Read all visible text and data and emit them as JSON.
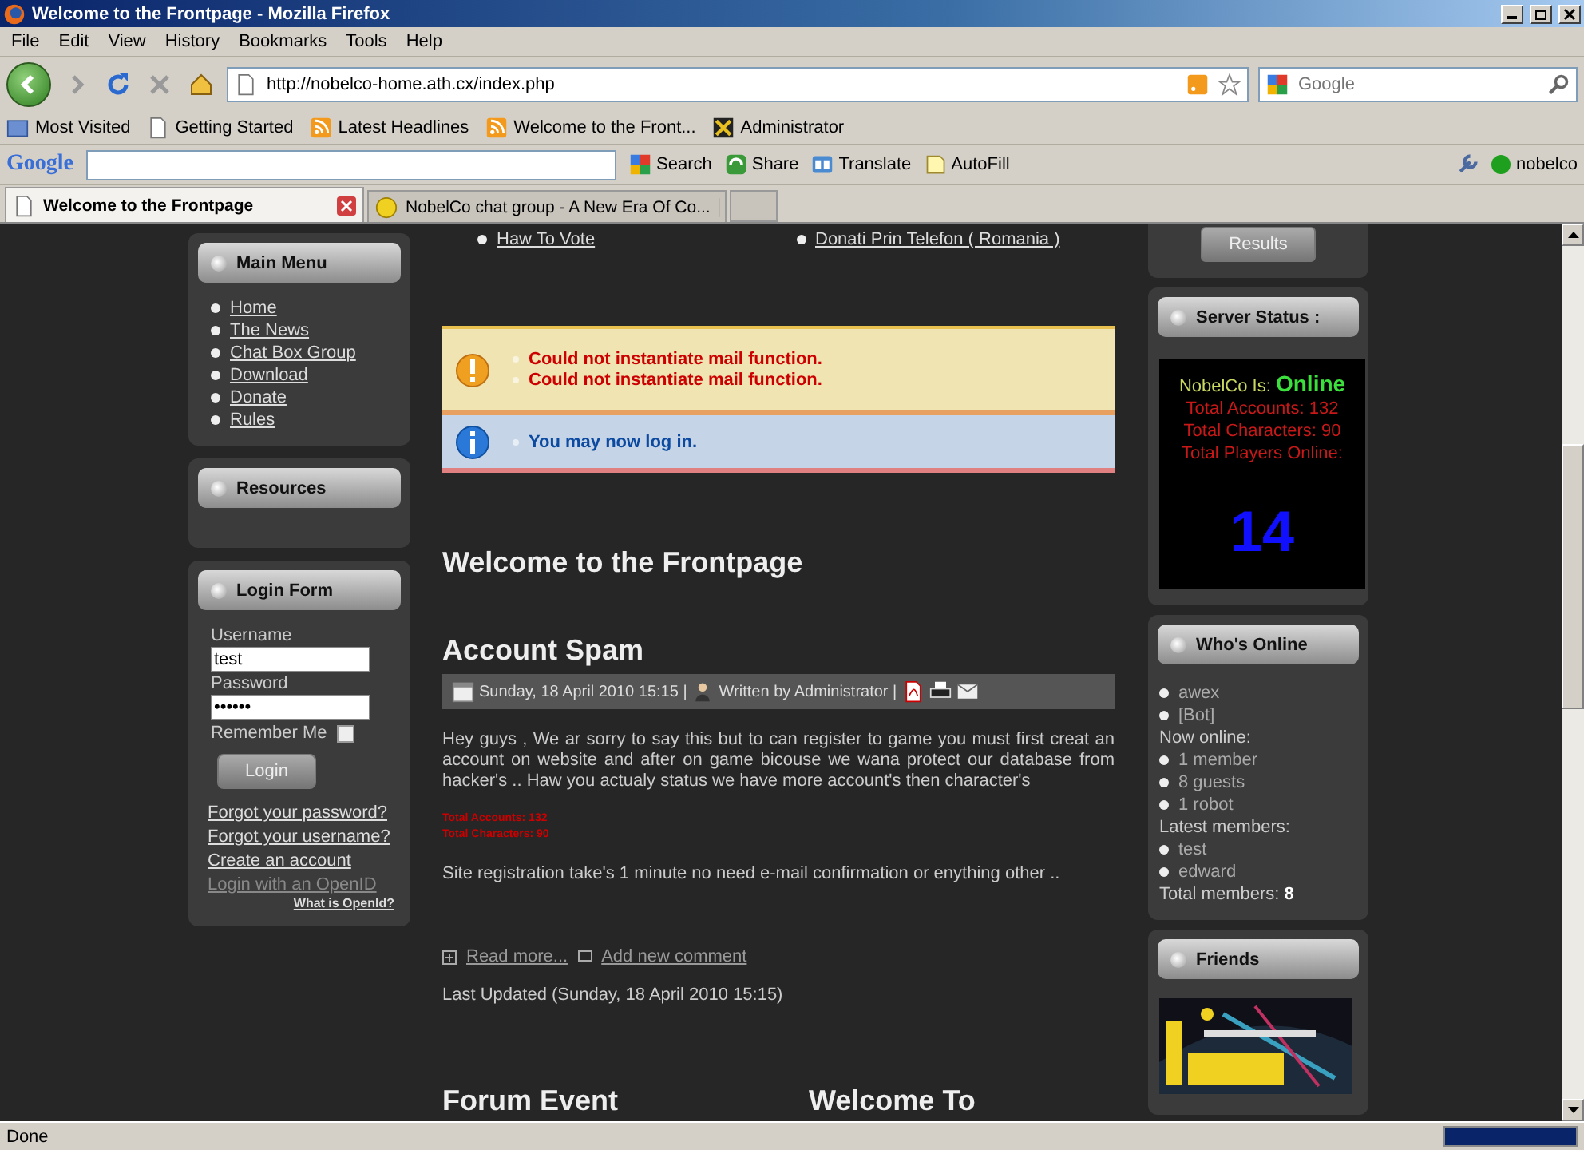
{
  "window": {
    "title": "Welcome to the Frontpage - Mozilla Firefox"
  },
  "menu_bar": [
    "File",
    "Edit",
    "View",
    "History",
    "Bookmarks",
    "Tools",
    "Help"
  ],
  "address_bar": {
    "url": "http://nobelco-home.ath.cx/index.php"
  },
  "search_box": {
    "placeholder": "Google"
  },
  "bookmarks": [
    {
      "label": "Most Visited",
      "kind": "folder"
    },
    {
      "label": "Getting Started",
      "kind": "page"
    },
    {
      "label": "Latest Headlines",
      "kind": "feed"
    },
    {
      "label": "Welcome to the Front...",
      "kind": "feed"
    },
    {
      "label": "Administrator",
      "kind": "app"
    }
  ],
  "google_toolbar": {
    "logo": "Google",
    "items": [
      {
        "label": "Search",
        "kind": "search"
      },
      {
        "label": "Share",
        "kind": "share"
      },
      {
        "label": "Translate",
        "kind": "translate"
      },
      {
        "label": "AutoFill",
        "kind": "autofill"
      }
    ],
    "account": "nobelco"
  },
  "tabs": [
    {
      "label": "Welcome to the Frontpage",
      "selected": true
    },
    {
      "label": "NobelCo chat group - A New Era Of Co...",
      "selected": false
    }
  ],
  "page": {
    "top_links": [
      "Haw To Vote",
      "Donati Prin Telefon ( Romania )"
    ],
    "main_menu": {
      "title": "Main Menu",
      "items": [
        "Home",
        "The News",
        "Chat Box Group",
        "Download",
        "Donate",
        "Rules"
      ]
    },
    "resources": {
      "title": "Resources"
    },
    "login_form": {
      "title": "Login Form",
      "username_label": "Username",
      "username_value": "test",
      "password_label": "Password",
      "password_value": "••••••",
      "remember_label": "Remember Me",
      "remember_checked": false,
      "login_button": "Login",
      "links": [
        {
          "label": "Forgot your password?",
          "disabled": false
        },
        {
          "label": "Forgot your username?",
          "disabled": false
        },
        {
          "label": "Create an account",
          "disabled": false
        },
        {
          "label": "Login with an OpenID",
          "disabled": true
        }
      ],
      "openid_help": "What is OpenId?"
    },
    "messages": [
      {
        "kind": "error",
        "lines": [
          "Could not instantiate mail function.",
          "Could not instantiate mail function."
        ]
      },
      {
        "kind": "info",
        "lines": [
          "You may now log in."
        ]
      }
    ],
    "page_heading": "Welcome to the Frontpage",
    "article": {
      "title": "Account Spam",
      "date": "Sunday, 18 April 2010 15:15 |",
      "author": "Written by Administrator |",
      "body": "Hey guys , We ar sorry to say this but to can register to game you must first creat an account on website and after on game bicouse we wana protect our database from hacker's .. Haw you actualy status we have more account's then character's",
      "stats": [
        "Total Accounts: 132",
        "Total Characters: 90"
      ],
      "note": "Site registration take's 1 minute no need e-mail confirmation or enything other ..",
      "read_more": "Read more...",
      "add_comment": "Add new comment",
      "last_updated": "Last Updated (Sunday, 18 April 2010 15:15)"
    },
    "bottom_headings": [
      "Forum Event",
      "Welcome To"
    ],
    "poll": {
      "button": "Results"
    },
    "server_status": {
      "title": "Server Status :",
      "label": "NobelCo Is:",
      "status": "Online",
      "lines": [
        "Total Accounts: 132",
        "Total Characters: 90",
        "Total Players Online:"
      ],
      "players": "14"
    },
    "whos_online": {
      "title": "Who's Online",
      "entries": [
        {
          "kind": "bullet",
          "text": "awex"
        },
        {
          "kind": "bullet",
          "text": "[Bot]"
        },
        {
          "kind": "label",
          "text": "Now online:"
        },
        {
          "kind": "bullet",
          "text": "1 member"
        },
        {
          "kind": "bullet",
          "text": "8 guests"
        },
        {
          "kind": "bullet",
          "text": "1 robot"
        },
        {
          "kind": "label",
          "text": "Latest members:"
        },
        {
          "kind": "bullet",
          "text": "test"
        },
        {
          "kind": "bullet",
          "text": "edward"
        },
        {
          "kind": "label",
          "text": "Total members: **8**"
        }
      ]
    },
    "friends": {
      "title": "Friends"
    }
  },
  "status_bar": {
    "text": "Done"
  }
}
